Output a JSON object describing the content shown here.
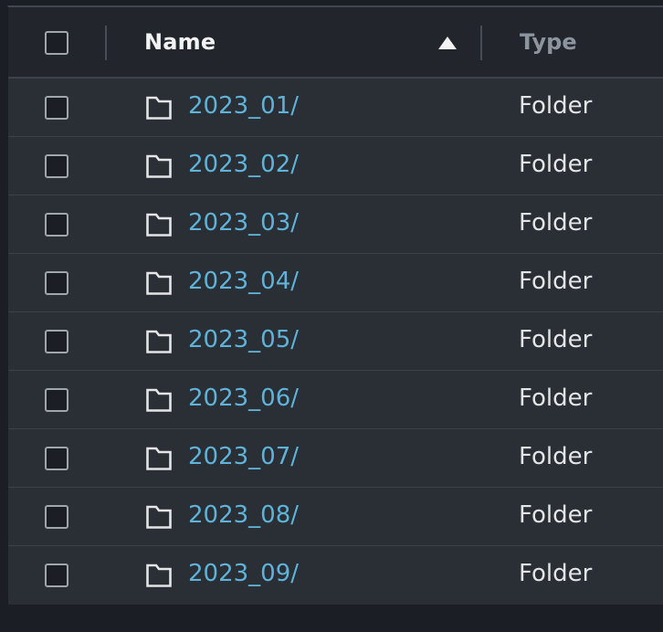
{
  "header": {
    "name_label": "Name",
    "type_label": "Type",
    "sort_direction": "ascending"
  },
  "rows": [
    {
      "name": "2023_01/",
      "type": "Folder"
    },
    {
      "name": "2023_02/",
      "type": "Folder"
    },
    {
      "name": "2023_03/",
      "type": "Folder"
    },
    {
      "name": "2023_04/",
      "type": "Folder"
    },
    {
      "name": "2023_05/",
      "type": "Folder"
    },
    {
      "name": "2023_06/",
      "type": "Folder"
    },
    {
      "name": "2023_07/",
      "type": "Folder"
    },
    {
      "name": "2023_08/",
      "type": "Folder"
    },
    {
      "name": "2023_09/",
      "type": "Folder"
    }
  ],
  "colors": {
    "link": "#5fb3d9",
    "header_text": "#f2f3f3",
    "muted_header_text": "#8c949e",
    "panel_bg": "#2a2e35"
  },
  "icons": {
    "row_icon": "folder-icon",
    "sort_icon": "sort-ascending-icon"
  }
}
